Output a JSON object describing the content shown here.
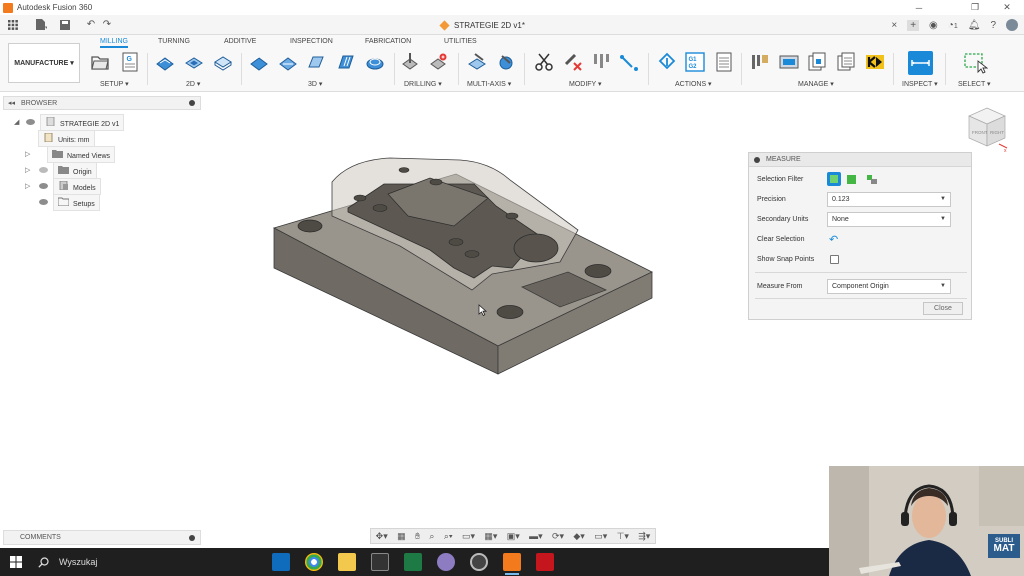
{
  "window": {
    "title": "Autodesk Fusion 360",
    "minimize": "─",
    "restore": "❐",
    "close": "✕"
  },
  "document_tab": {
    "name": "STRATEGIE 2D v1*",
    "close": "×"
  },
  "quickbar": {
    "notification_count": "1"
  },
  "ribbon": {
    "workspace": "MANUFACTURE ▾",
    "tabs": [
      "MILLING",
      "TURNING",
      "ADDITIVE",
      "INSPECTION",
      "FABRICATION",
      "UTILITIES"
    ],
    "groups": {
      "setup": "SETUP ▾",
      "twod": "2D ▾",
      "threed": "3D ▾",
      "drilling": "DRILLING ▾",
      "multiaxis": "MULTI-AXIS ▾",
      "modify": "MODIFY ▾",
      "actions": "ACTIONS ▾",
      "manage": "MANAGE ▾",
      "inspect": "INSPECT ▾",
      "select": "SELECT ▾"
    },
    "g1g2_label": "G1\nG2"
  },
  "browser": {
    "title": "BROWSER",
    "items": [
      {
        "label": "STRATEGIE 2D v1"
      },
      {
        "label": "Units: mm"
      },
      {
        "label": "Named Views"
      },
      {
        "label": "Origin"
      },
      {
        "label": "Models"
      },
      {
        "label": "Setups"
      }
    ]
  },
  "comments": {
    "title": "COMMENTS"
  },
  "measure": {
    "title": "MEASURE",
    "selection_filter_label": "Selection Filter",
    "precision_label": "Precision",
    "precision_value": "0.123",
    "secondary_units_label": "Secondary Units",
    "secondary_units_value": "None",
    "clear_selection_label": "Clear Selection",
    "show_snap_points_label": "Show Snap Points",
    "measure_from_label": "Measure From",
    "measure_from_value": "Component Origin",
    "close_label": "Close"
  },
  "viewcube": {
    "front": "FRONT",
    "right": "RIGHT"
  },
  "taskbar": {
    "search_placeholder": "Wyszukaj"
  },
  "webcam": {
    "logo_top": "SUBLI",
    "logo_bottom": "MAT"
  },
  "colors": {
    "accent": "#1a8ad8",
    "part": "#8a857c",
    "taskbar": "#1f1f1f"
  }
}
